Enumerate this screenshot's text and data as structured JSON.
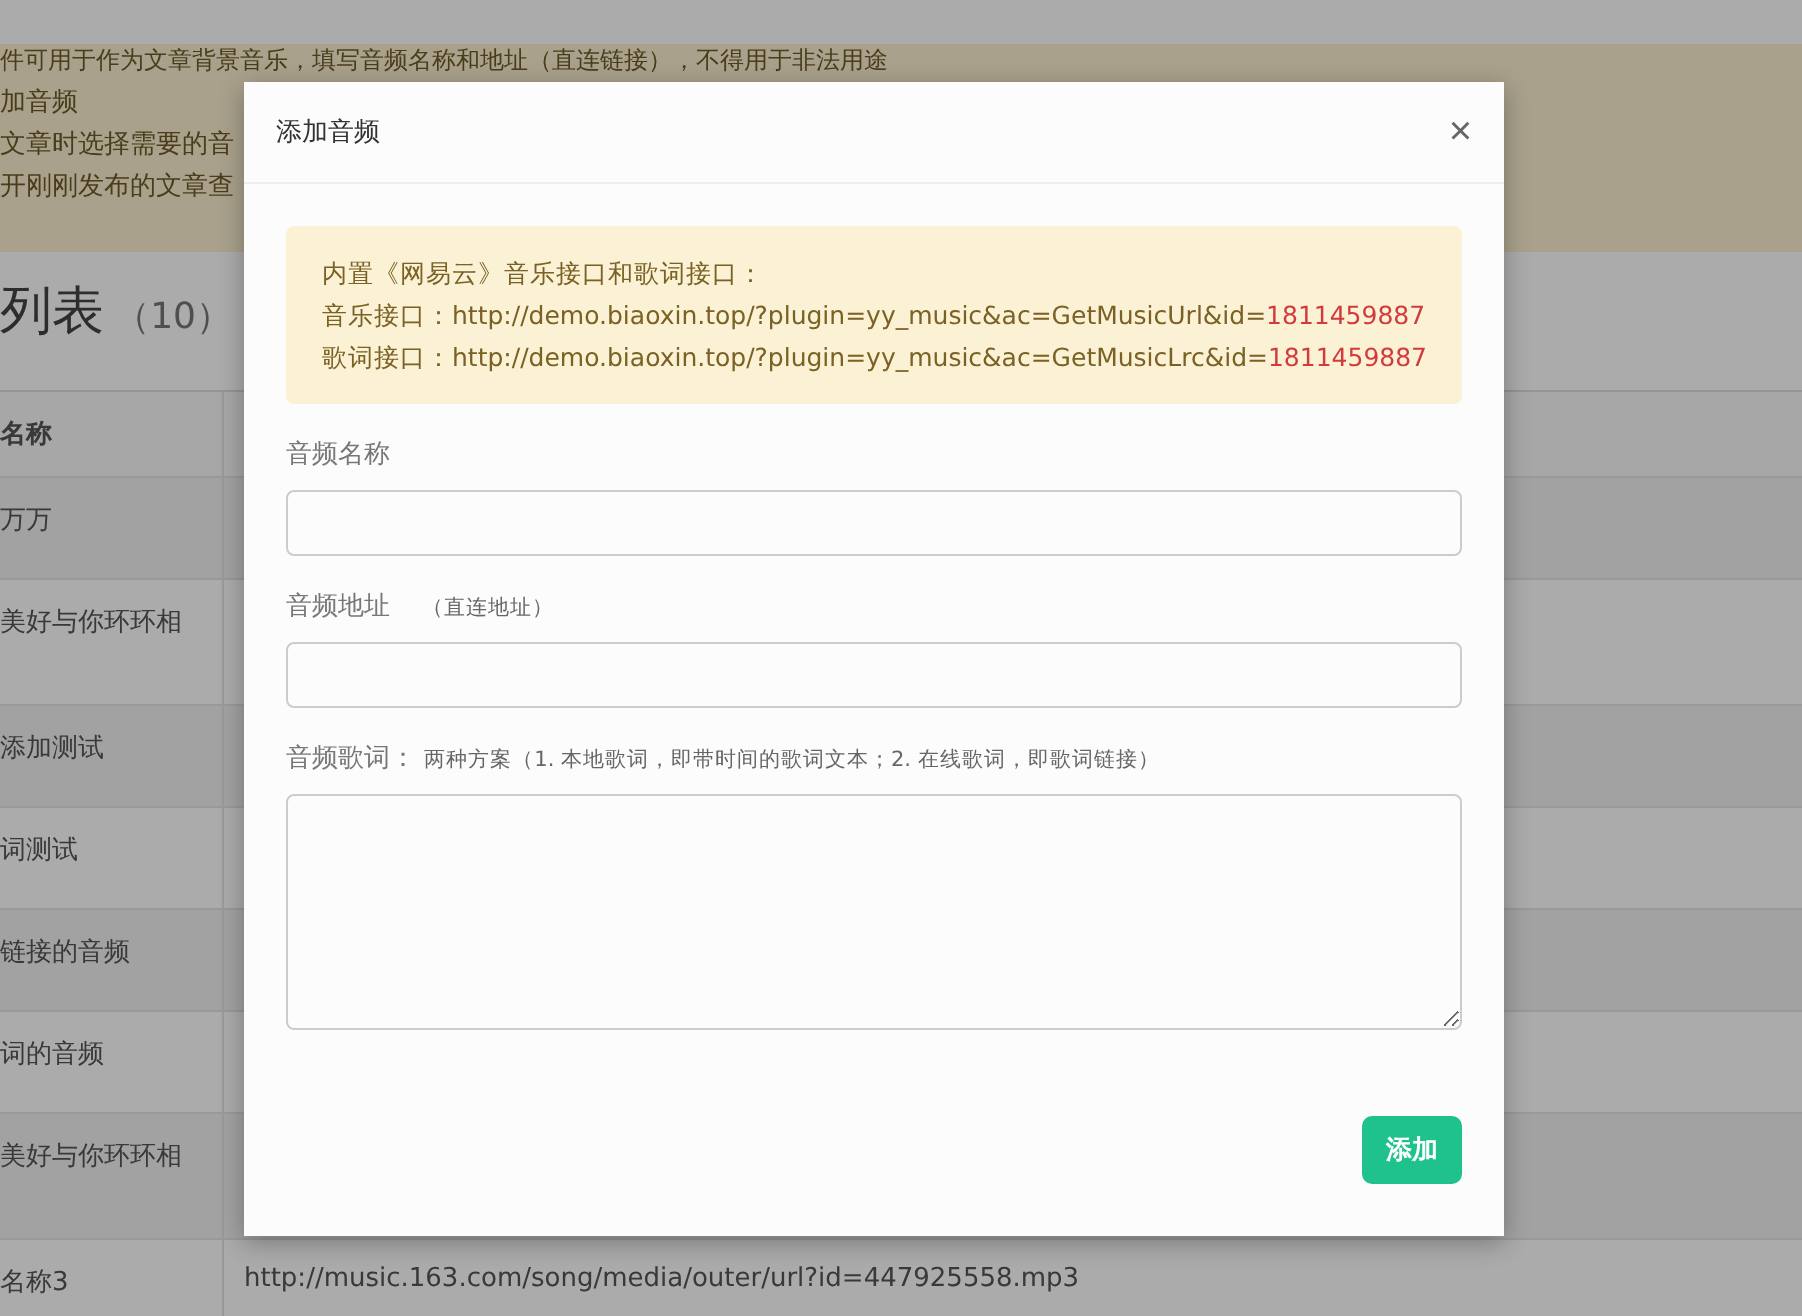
{
  "notice_lines": [
    "件可用于作为文章背景音乐，填写音频名称和地址（直连链接），不得用于非法用途",
    "加音频",
    "文章时选择需要的音",
    "开刚刚发布的文章查"
  ],
  "list_title": {
    "text": "列表",
    "count": "（10）"
  },
  "table": {
    "header": "名称",
    "rows": [
      {
        "name": "万万",
        "url": ""
      },
      {
        "name": "美好与你环环相",
        "url": ""
      },
      {
        "name": "添加测试",
        "url": ""
      },
      {
        "name": "词测试",
        "url": ""
      },
      {
        "name": "链接的音频",
        "url": ""
      },
      {
        "name": "词的音频",
        "url": ""
      },
      {
        "name": "美好与你环环相",
        "url": ""
      },
      {
        "name": "名称3",
        "url": "http://music.163.com/song/media/outer/url?id=447925558.mp3"
      }
    ]
  },
  "dialog": {
    "title": "添加音频",
    "close": "×",
    "alert": {
      "heading": "内置《网易云》音乐接口和歌词接口：",
      "lines": [
        {
          "label": "音乐接口：http://demo.biaoxin.top/?plugin=yy_music&ac=GetMusicUrl&id=",
          "id": "1811459887"
        },
        {
          "label": "歌词接口：http://demo.biaoxin.top/?plugin=yy_music&ac=GetMusicLrc&id=",
          "id": "1811459887"
        }
      ]
    },
    "fields": [
      {
        "kind": "input",
        "label": "音频名称"
      },
      {
        "kind": "input",
        "label": "音频地址",
        "hint": "（直连地址）"
      },
      {
        "kind": "textarea",
        "label": "音频歌词：",
        "hint": "两种方案（1. 本地歌词，即带时间的歌词文本；2. 在线歌词，即歌词链接）"
      }
    ],
    "submit": "添加"
  }
}
